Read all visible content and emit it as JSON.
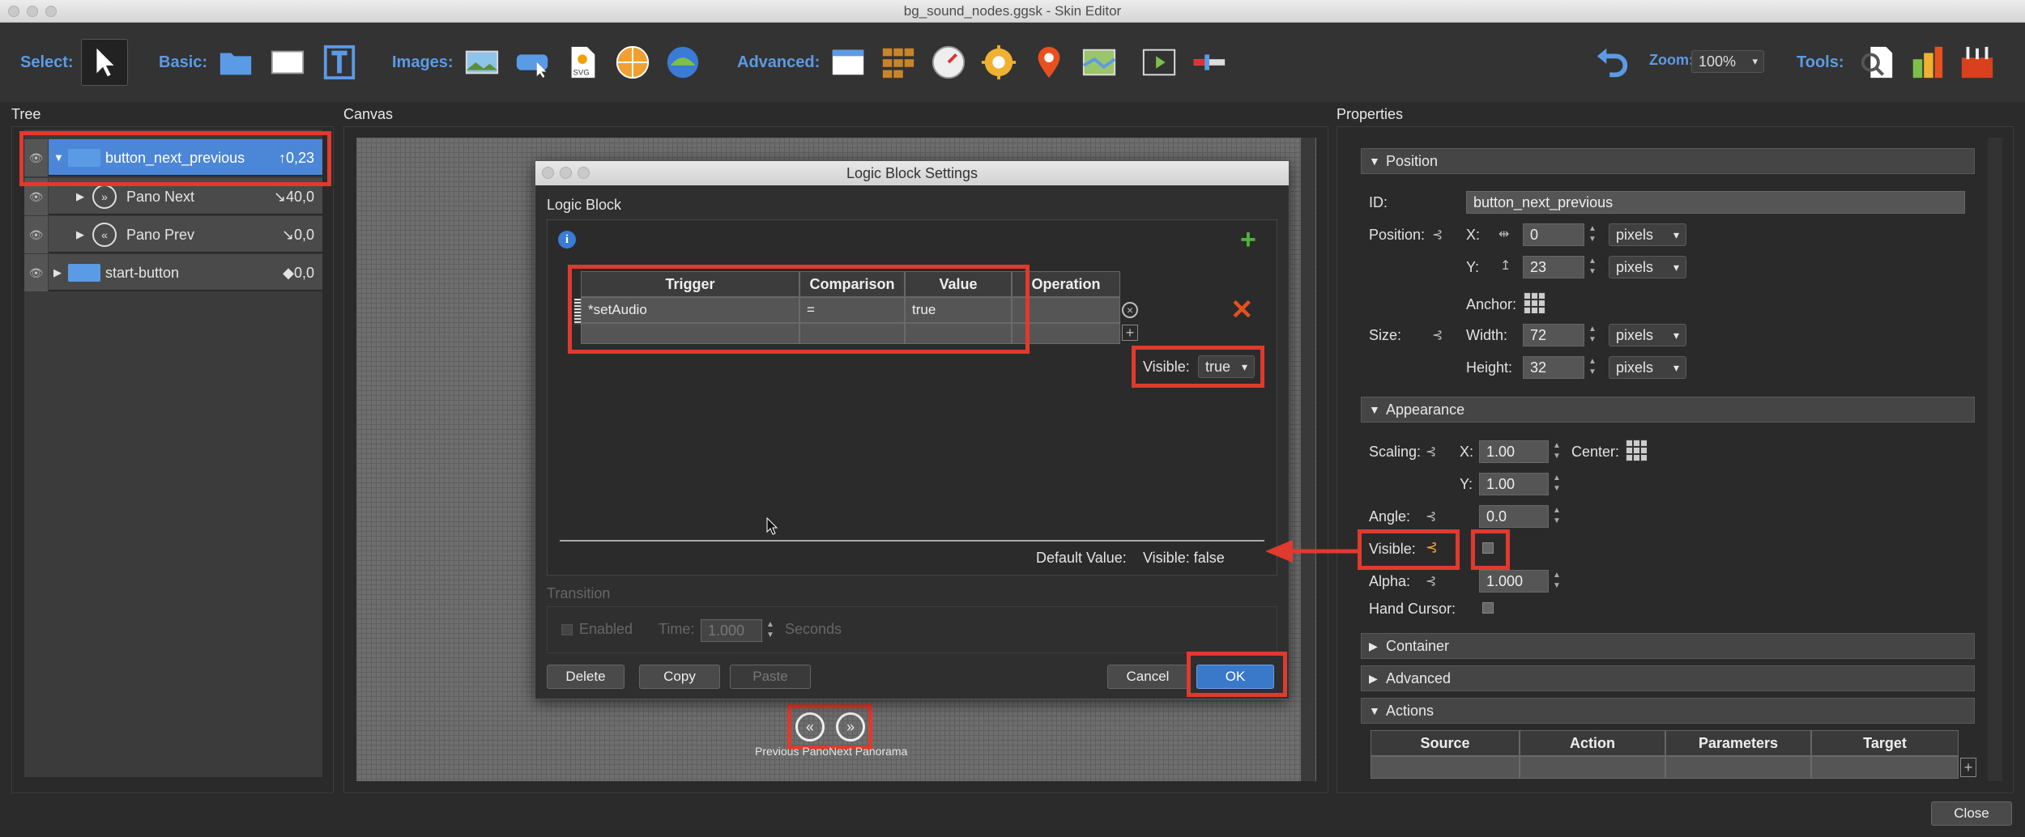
{
  "window": {
    "title": "bg_sound_nodes.ggsk - Skin Editor"
  },
  "toolbar": {
    "select_label": "Select:",
    "basic_label": "Basic:",
    "images_label": "Images:",
    "advanced_label": "Advanced:",
    "zoom_label": "Zoom:",
    "zoom_value": "100%",
    "tools_label": "Tools:"
  },
  "panels": {
    "tree": "Tree",
    "canvas": "Canvas",
    "properties": "Properties"
  },
  "tree": {
    "items": [
      {
        "label": "button_next_previous",
        "value": "↑0,23"
      },
      {
        "label": "Pano Next",
        "value": "↘40,0"
      },
      {
        "label": "Pano Prev",
        "value": "↘0,0"
      },
      {
        "label": "start-button",
        "value": "◆0,0"
      }
    ]
  },
  "dialog": {
    "title": "Logic Block Settings",
    "section": "Logic Block",
    "columns": [
      "Trigger",
      "Comparison",
      "Value",
      "Operation"
    ],
    "row": {
      "trigger": "*setAudio",
      "comparison": "=",
      "value": "true",
      "operation": ""
    },
    "visible_label": "Visible:",
    "visible_value": "true",
    "default_value_label": "Default Value:",
    "default_value": "Visible:  false",
    "transition_label": "Transition",
    "enabled_label": "Enabled",
    "time_label": "Time:",
    "time_value": "1.000",
    "seconds_label": "Seconds",
    "buttons": {
      "delete": "Delete",
      "copy": "Copy",
      "paste": "Paste",
      "cancel": "Cancel",
      "ok": "OK"
    }
  },
  "canvas": {
    "button_caption": "Previous PanoNext Panorama"
  },
  "properties": {
    "position_section": "Position",
    "id_label": "ID:",
    "id_value": "button_next_previous",
    "position_label": "Position:",
    "x_label": "X:",
    "x_value": "0",
    "y_label": "Y:",
    "y_value": "23",
    "unit": "pixels",
    "anchor_label": "Anchor:",
    "size_label": "Size:",
    "width_label": "Width:",
    "width_value": "72",
    "height_label": "Height:",
    "height_value": "32",
    "appearance_section": "Appearance",
    "scaling_label": "Scaling:",
    "scale_x": "1.00",
    "scale_y": "1.00",
    "center_label": "Center:",
    "angle_label": "Angle:",
    "angle_value": "0.0",
    "visible_label": "Visible:",
    "alpha_label": "Alpha:",
    "alpha_value": "1.000",
    "hand_cursor_label": "Hand Cursor:",
    "container_section": "Container",
    "advanced_section": "Advanced",
    "actions_section": "Actions",
    "action_columns": [
      "Source",
      "Action",
      "Parameters",
      "Target"
    ]
  },
  "footer": {
    "close": "Close"
  },
  "colors": {
    "accent": "#5b9be6",
    "selection": "#4b87d6",
    "highlight": "#e03a2e"
  }
}
